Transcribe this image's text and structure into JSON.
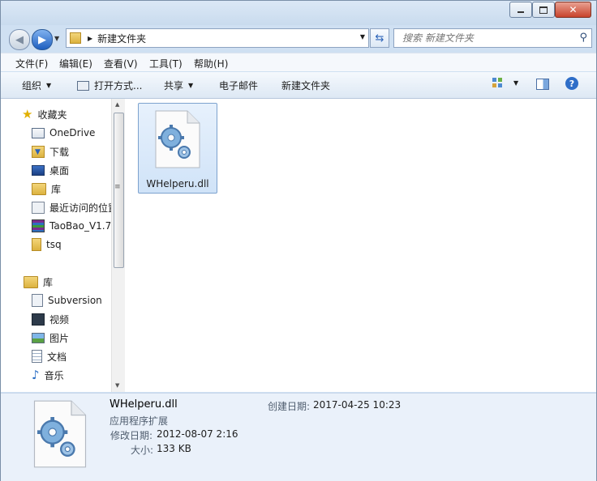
{
  "address": {
    "current": "新建文件夹"
  },
  "search": {
    "placeholder": "搜索 新建文件夹"
  },
  "menu": [
    "文件(F)",
    "编辑(E)",
    "查看(V)",
    "工具(T)",
    "帮助(H)"
  ],
  "toolbar": {
    "organize": "组织",
    "open_with": "打开方式...",
    "share": "共享",
    "email": "电子邮件",
    "new_folder": "新建文件夹"
  },
  "sidebar": {
    "favorites_label": "收藏夹",
    "favorites": [
      "OneDrive",
      "下载",
      "桌面",
      "库",
      "最近访问的位置",
      "TaoBao_V1.7",
      "tsq"
    ],
    "library_label": "库",
    "library": [
      "Subversion",
      "视频",
      "图片",
      "文档",
      "音乐"
    ]
  },
  "file": {
    "name": "WHelperu.dll"
  },
  "details": {
    "name": "WHelperu.dll",
    "type": "应用程序扩展",
    "modified_label": "修改日期:",
    "modified": "2012-08-07 2:16",
    "size_label": "大小:",
    "size": "133 KB",
    "created_label": "创建日期:",
    "created": "2017-04-25 10:23"
  }
}
